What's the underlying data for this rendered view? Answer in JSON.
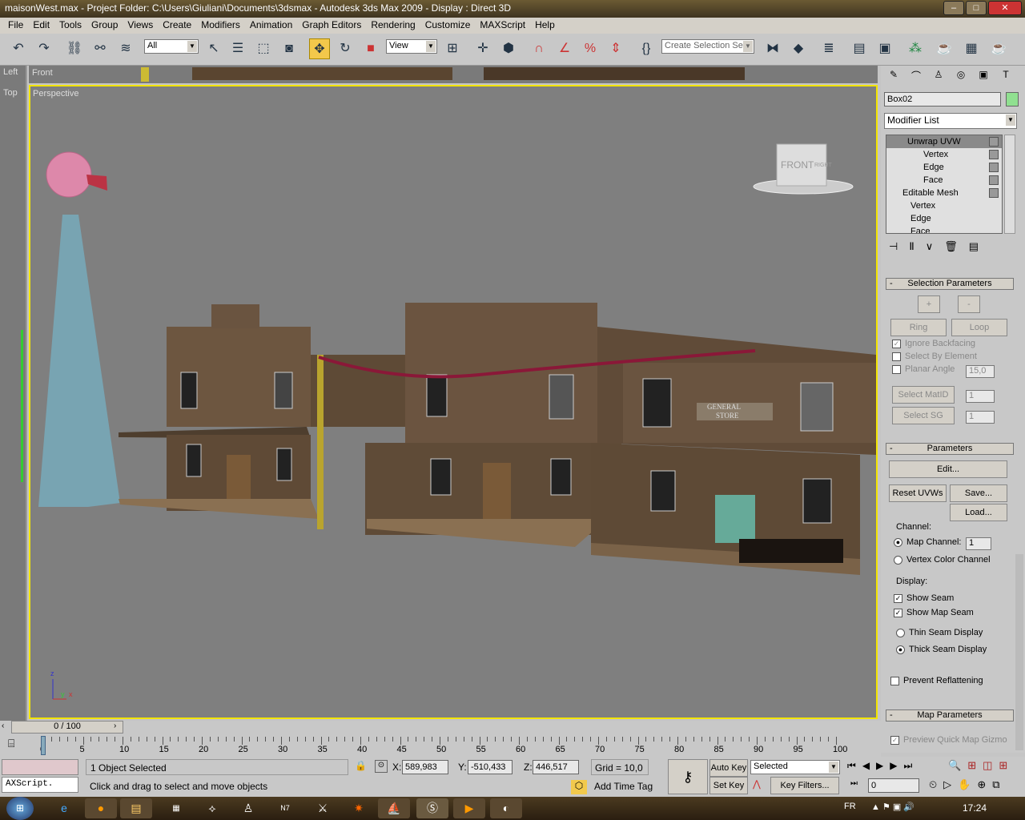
{
  "window": {
    "title": "maisonWest.max    - Project Folder: C:\\Users\\Giuliani\\Documents\\3dsmax    - Autodesk 3ds Max  2009     - Display : Direct 3D"
  },
  "menu": [
    "File",
    "Edit",
    "Tools",
    "Group",
    "Views",
    "Create",
    "Modifiers",
    "Animation",
    "Graph Editors",
    "Rendering",
    "Customize",
    "MAXScript",
    "Help"
  ],
  "toolbar": {
    "filter": "All",
    "coord": "View",
    "selection_set_placeholder": "Create Selection Set"
  },
  "viewports": {
    "left": "Left",
    "top": "Top",
    "front": "Front",
    "perspective": "Perspective",
    "viewcube_front": "FRONT",
    "viewcube_right": "RIGHT",
    "sign_line1": "GENERAL",
    "sign_line2": "STORE",
    "axis_z": "z",
    "axis_x": "x",
    "axis_y": "y"
  },
  "command_panel": {
    "object_name": "Box02",
    "object_color": "#90e090",
    "modifier_list": "Modifier List",
    "stack": [
      {
        "label": "Unwrap UVW",
        "level": 0,
        "active": true
      },
      {
        "label": "Vertex",
        "level": 1
      },
      {
        "label": "Edge",
        "level": 1
      },
      {
        "label": "Face",
        "level": 1
      },
      {
        "label": "Editable Mesh",
        "level": 0
      },
      {
        "label": "Vertex",
        "level": 1
      },
      {
        "label": "Edge",
        "level": 1
      },
      {
        "label": "Face",
        "level": 1
      }
    ],
    "selection_parameters": {
      "title": "Selection Parameters",
      "plus": "+",
      "minus": "-",
      "ring": "Ring",
      "loop": "Loop",
      "ignore_backfacing": "Ignore Backfacing",
      "select_by_element": "Select By Element",
      "planar_angle": "Planar Angle",
      "planar_angle_value": "15,0",
      "select_matid": "Select MatID",
      "matid_value": "1",
      "select_sg": "Select SG",
      "sg_value": "1"
    },
    "parameters": {
      "title": "Parameters",
      "edit": "Edit...",
      "reset_uvws": "Reset UVWs",
      "save": "Save...",
      "load": "Load...",
      "channel_label": "Channel:",
      "map_channel": "Map Channel:",
      "map_channel_value": "1",
      "vertex_color_channel": "Vertex Color Channel",
      "display_label": "Display:",
      "show_seam": "Show Seam",
      "show_map_seam": "Show Map Seam",
      "thin_seam": "Thin Seam Display",
      "thick_seam": "Thick Seam Display",
      "prevent_reflattening": "Prevent Reflattening"
    },
    "map_parameters": {
      "title": "Map Parameters",
      "preview_quick_map": "Preview Quick Map Gizmo"
    }
  },
  "timeline": {
    "frame": "0 / 100",
    "ticks": [
      "0",
      "5",
      "10",
      "15",
      "20",
      "25",
      "30",
      "35",
      "40",
      "45",
      "50",
      "55",
      "60",
      "65",
      "70",
      "75",
      "80",
      "85",
      "90",
      "95",
      "100"
    ]
  },
  "status": {
    "selected": "1 Object Selected",
    "prompt": "Click and drag to select and move objects",
    "maxscript": "AXScript.",
    "x": "589,983",
    "y": "-510,433",
    "z": "446,517",
    "grid": "Grid = 10,0",
    "add_time_tag": "Add Time Tag",
    "auto_key": "Auto Key",
    "set_key": "Set Key",
    "key_mode": "Selected",
    "key_filters": "Key Filters...",
    "current_frame": "0",
    "x_label": "X:",
    "y_label": "Y:",
    "z_label": "Z:"
  },
  "taskbar": {
    "language": "FR",
    "clock": "17:24"
  }
}
